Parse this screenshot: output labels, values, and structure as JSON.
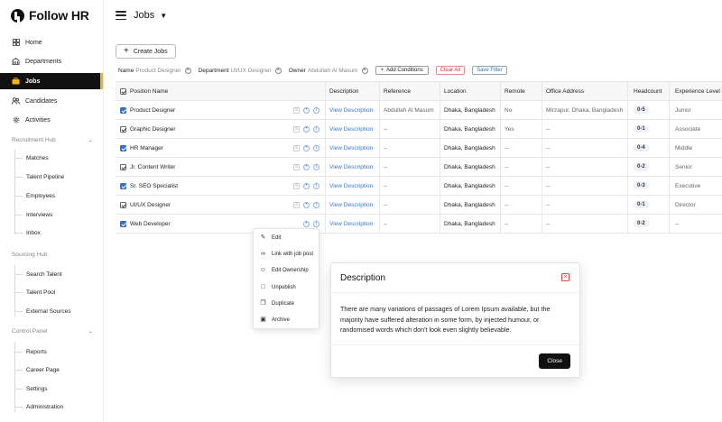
{
  "app": {
    "brand": "Follow HR"
  },
  "header": {
    "title": "Jobs"
  },
  "sidebar": {
    "items": [
      {
        "label": "Home",
        "icon": "grid-icon",
        "active": false
      },
      {
        "label": "Departments",
        "icon": "building-icon",
        "active": false
      },
      {
        "label": "Jobs",
        "icon": "briefcase-icon",
        "active": true
      },
      {
        "label": "Candidates",
        "icon": "users-icon",
        "active": false
      },
      {
        "label": "Activities",
        "icon": "gear-icon",
        "active": false
      }
    ],
    "sections": [
      {
        "title": "Recruitment Hub",
        "items": [
          "Matches",
          "Talent Pipeline",
          "Employees",
          "Interviews",
          "Inbox"
        ]
      },
      {
        "title": "Sourcing Hub",
        "items": [
          "Search Talent",
          "Talent Pool",
          "External Sources"
        ]
      },
      {
        "title": "Control Panel",
        "items": [
          "Reports",
          "Career Page",
          "Settings",
          "Administration"
        ]
      }
    ]
  },
  "toolbar": {
    "create_label": "Create Jobs",
    "filters": [
      {
        "key": "Name",
        "value": "Product Designer"
      },
      {
        "key": "Department",
        "value": "UI/UX Designer"
      },
      {
        "key": "Owner",
        "value": "Abdullah Al Masum"
      }
    ],
    "add_conditions": "Add Conditions",
    "clear_all": "Clear All",
    "save_filter": "Save Filter"
  },
  "table": {
    "columns": [
      "Position Name",
      "Description",
      "Reference",
      "Location",
      "Remote",
      "Office Address",
      "Headcount",
      "Experience Level"
    ],
    "rows": [
      {
        "position": "Product Designer",
        "checked": true,
        "description": "View Description",
        "reference": "Abdullah Al Masum",
        "location": "Dhaka, Bangladesh",
        "remote": "No",
        "office": "Mirzapur, Dhaka, Bangladesh",
        "headcount": "0-5",
        "experience": "Junior"
      },
      {
        "position": "Graphic Designer",
        "checked": false,
        "description": "View Description",
        "reference": "--",
        "location": "Dhaka, Bangladesh",
        "remote": "Yes",
        "office": "--",
        "headcount": "0-1",
        "experience": "Associate"
      },
      {
        "position": "HR Manager",
        "checked": true,
        "description": "View Description",
        "reference": "--",
        "location": "Dhaka, Bangladesh",
        "remote": "--",
        "office": "--",
        "headcount": "0-4",
        "experience": "Middle"
      },
      {
        "position": "Jr. Content Writer",
        "checked": false,
        "description": "View Description",
        "reference": "--",
        "location": "Dhaka, Bangladesh",
        "remote": "--",
        "office": "--",
        "headcount": "0-2",
        "experience": "Senior"
      },
      {
        "position": "Sr. SEO Specialist",
        "checked": true,
        "description": "View Description",
        "reference": "--",
        "location": "Dhaka, Bangladesh",
        "remote": "--",
        "office": "--",
        "headcount": "0-3",
        "experience": "Executive"
      },
      {
        "position": "UI/UX Designer",
        "checked": false,
        "description": "View Description",
        "reference": "--",
        "location": "Dhaka, Bangladesh",
        "remote": "--",
        "office": "--",
        "headcount": "0-1",
        "experience": "Director"
      },
      {
        "position": "Web Developer",
        "checked": true,
        "description": "View Description",
        "reference": "--",
        "location": "Dhaka, Bangladesh",
        "remote": "--",
        "office": "--",
        "headcount": "0-2",
        "experience": "--"
      }
    ]
  },
  "context_menu": {
    "items": [
      {
        "label": "Edit",
        "icon": "pencil-icon"
      },
      {
        "label": "Link with job post",
        "icon": "link-icon"
      },
      {
        "label": "Edit Ownership",
        "icon": "user-edit-icon"
      },
      {
        "label": "Unpublish",
        "icon": "unpublish-icon"
      },
      {
        "label": "Duplicate",
        "icon": "copy-icon"
      },
      {
        "label": "Archive",
        "icon": "archive-icon"
      }
    ]
  },
  "modal": {
    "title": "Description",
    "body": "There are many variations of passages of Lorem Ipsum available, but the majority have suffered alteration in some form, by injected humour, or randomised words which don't look even slightly believable.",
    "close_label": "Close"
  },
  "colors": {
    "accent": "#f5b700",
    "link": "#3a7ad3",
    "checkbox": "#2f6fd1",
    "danger": "#e44444"
  }
}
